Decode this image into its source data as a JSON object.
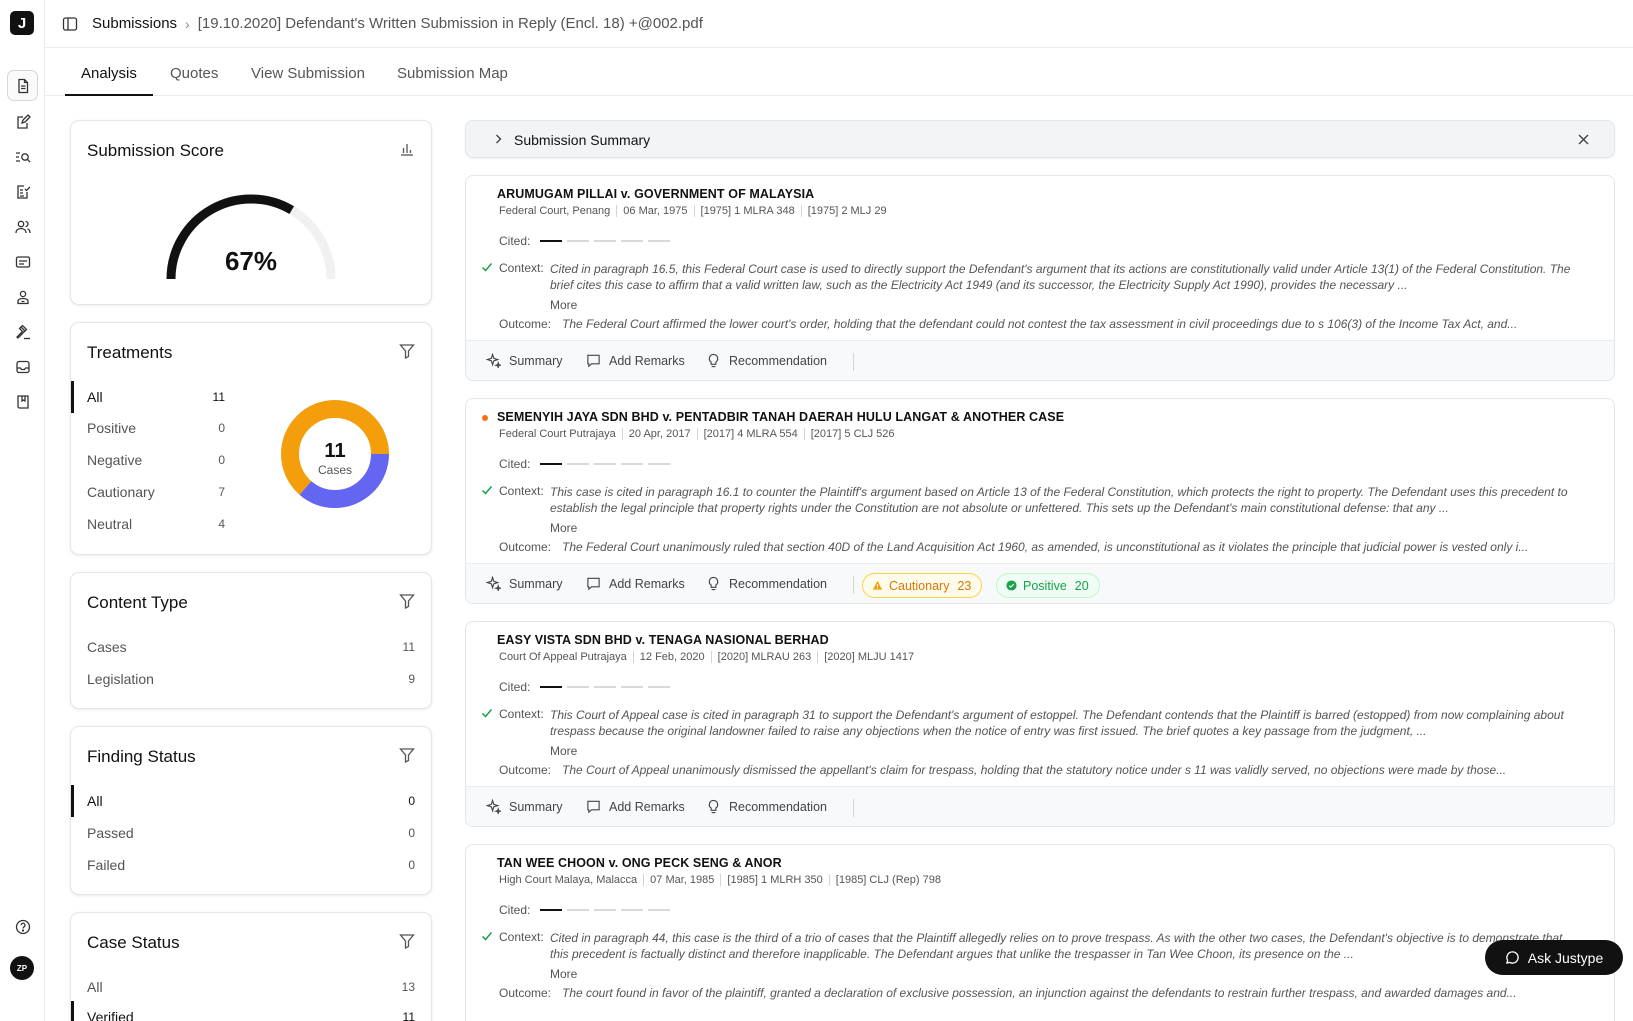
{
  "header": {
    "breadcrumb_root": "Submissions",
    "breadcrumb_file": "[19.10.2020] Defendant's Written Submission in Reply (Encl. 18) +@002.pdf"
  },
  "tabs": [
    {
      "label": "Analysis",
      "active": true
    },
    {
      "label": "Quotes"
    },
    {
      "label": "View Submission"
    },
    {
      "label": "Submission Map"
    }
  ],
  "score": {
    "title": "Submission Score",
    "value": "67%",
    "fraction": 0.67
  },
  "treatments": {
    "title": "Treatments",
    "items": [
      {
        "label": "All",
        "count": "11"
      },
      {
        "label": "Positive",
        "count": "0"
      },
      {
        "label": "Negative",
        "count": "0"
      },
      {
        "label": "Cautionary",
        "count": "7"
      },
      {
        "label": "Neutral",
        "count": "4"
      }
    ],
    "donut_total": "11",
    "donut_caption": "Cases",
    "colors": {
      "cautionary": "#f59e0b",
      "neutral": "#6366f1"
    }
  },
  "content_type": {
    "title": "Content Type",
    "items": [
      {
        "label": "Cases",
        "count": "11"
      },
      {
        "label": "Legislation",
        "count": "9"
      }
    ]
  },
  "finding_status": {
    "title": "Finding Status",
    "items": [
      {
        "label": "All",
        "count": "0"
      },
      {
        "label": "Passed",
        "count": "0"
      },
      {
        "label": "Failed",
        "count": "0"
      }
    ]
  },
  "case_status": {
    "title": "Case Status",
    "items": [
      {
        "label": "All",
        "count": "13"
      },
      {
        "label": "Verified",
        "count": "11"
      }
    ]
  },
  "summary_bar": {
    "label": "Submission Summary"
  },
  "labels": {
    "cited": "Cited:",
    "context": "Context:",
    "outcome": "Outcome:",
    "more": "More",
    "summary": "Summary",
    "add_remarks": "Add Remarks",
    "recommendation": "Recommendation"
  },
  "cases": [
    {
      "title": "ARUMUGAM PILLAI v. GOVERNMENT OF MALAYSIA",
      "court": "Federal Court, Penang",
      "date": "06 Mar, 1975",
      "citation1": "[1975] 1 MLRA 348",
      "citation2": "[1975] 2 MLJ 29",
      "context": "Cited in paragraph 16.5, this Federal Court case is used to directly support the Defendant's argument that its actions are constitutionally valid under Article 13(1) of the Federal Constitution. The brief cites this case to affirm that a valid written law, such as the Electricity Act 1949 (and its successor, the Electricity Supply Act 1990), provides the necessary ...",
      "outcome": "The Federal Court affirmed the lower court's order, holding that the defendant could not contest the tax assessment in civil proceedings due to s 106(3) of the Income Tax Act, and..."
    },
    {
      "title": "SEMENYIH JAYA SDN BHD v. PENTADBIR TANAH DAERAH HULU LANGAT & ANOTHER CASE",
      "court": "Federal Court Putrajaya",
      "date": "20 Apr, 2017",
      "citation1": "[2017] 4 MLRA 554",
      "citation2": "[2017] 5 CLJ 526",
      "context": "This case is cited in paragraph 16.1 to counter the Plaintiff's argument based on Article 13 of the Federal Constitution, which protects the right to property. The Defendant uses this precedent to establish the legal principle that property rights under the Constitution are not absolute or unfettered. This sets up the Defendant's main constitutional defense: that any ...",
      "outcome": "The Federal Court unanimously ruled that section 40D of the Land Acquisition Act 1960, as amended, is unconstitutional as it violates the principle that judicial power is vested only i...",
      "badges": {
        "cautionary_label": "Cautionary",
        "cautionary_count": "23",
        "positive_label": "Positive",
        "positive_count": "20"
      }
    },
    {
      "title": "EASY VISTA SDN BHD v. TENAGA NASIONAL BERHAD",
      "court": "Court Of Appeal Putrajaya",
      "date": "12 Feb, 2020",
      "citation1": "[2020] MLRAU 263",
      "citation2": "[2020] MLJU 1417",
      "context": "This Court of Appeal case is cited in paragraph 31 to support the Defendant's argument of estoppel. The Defendant contends that the Plaintiff is barred (estopped) from now complaining about trespass because the original landowner failed to raise any objections when the notice of entry was first issued. The brief quotes a key passage from the judgment, ...",
      "outcome": "The Court of Appeal unanimously dismissed the appellant's claim for trespass, holding that the statutory notice under s 11 was validly served, no objections were made by those..."
    },
    {
      "title": "TAN WEE CHOON v. ONG PECK SENG & ANOR",
      "court": "High Court Malaya, Malacca",
      "date": "07 Mar, 1985",
      "citation1": "[1985] 1 MLRH 350",
      "citation2": "[1985] CLJ (Rep) 798",
      "context": "Cited in paragraph 44, this case is the third of a trio of cases that the Plaintiff allegedly relies on to prove trespass. As with the other two cases, the Defendant's objective is to demonstrate that this precedent is factually distinct and therefore inapplicable. The Defendant argues that unlike the trespasser in Tan Wee Choon, its presence on the ...",
      "outcome": "The court found in favor of the plaintiff, granted a declaration of exclusive possession, an injunction against the defendants to restrain further trespass, and awarded damages and..."
    }
  ],
  "ask_button": {
    "label": "Ask Justype"
  },
  "user": {
    "initials": "ZP"
  },
  "logo": {
    "letter": "J"
  }
}
